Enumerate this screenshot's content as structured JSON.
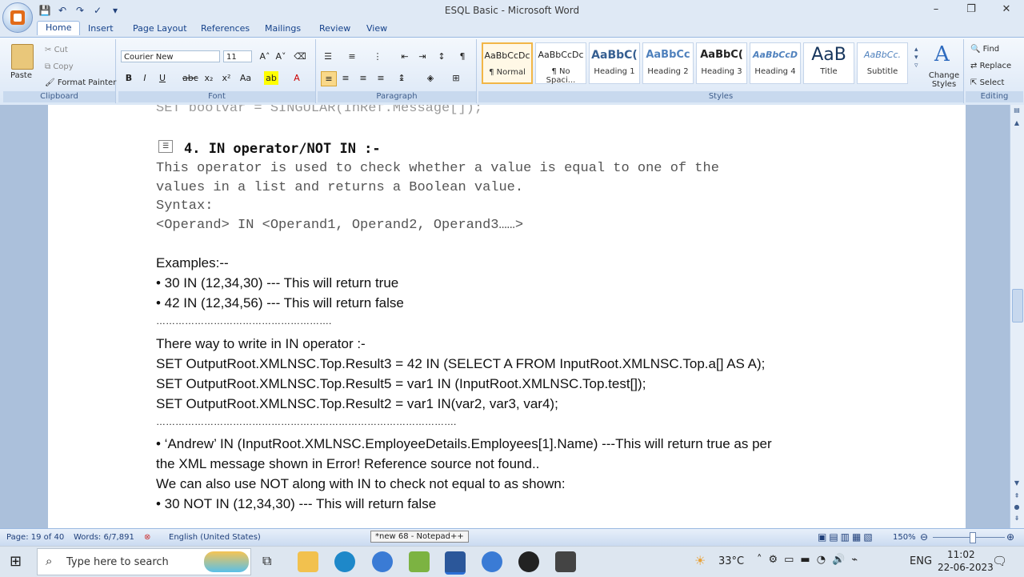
{
  "window": {
    "title": "ESQL Basic - Microsoft Word",
    "controls": [
      "–",
      "❐",
      "✕"
    ]
  },
  "tabs": [
    "Home",
    "Insert",
    "Page Layout",
    "References",
    "Mailings",
    "Review",
    "View"
  ],
  "ribbon": {
    "clipboard": {
      "paste": "Paste",
      "cut": "Cut",
      "copy": "Copy",
      "format_painter": "Format Painter",
      "label": "Clipboard"
    },
    "font": {
      "name": "Courier New",
      "size": "11",
      "label": "Font"
    },
    "paragraph": {
      "label": "Paragraph"
    },
    "styles": {
      "items": [
        {
          "preview": "AaBbCcDc",
          "name": "¶ Normal"
        },
        {
          "preview": "AaBbCcDc",
          "name": "¶ No Spaci..."
        },
        {
          "preview": "AaBbC(",
          "name": "Heading 1"
        },
        {
          "preview": "AaBbCc",
          "name": "Heading 2"
        },
        {
          "preview": "AaBbC(",
          "name": "Heading 3"
        },
        {
          "preview": "AaBbCcD",
          "name": "Heading 4"
        },
        {
          "preview": "AaB",
          "name": "Title"
        },
        {
          "preview": "AaBbCc.",
          "name": "Subtitle"
        }
      ],
      "change_styles": "Change Styles",
      "label": "Styles"
    },
    "editing": {
      "find": "Find",
      "replace": "Replace",
      "select": "Select",
      "label": "Editing"
    }
  },
  "document": {
    "cut_line": "SET boolvar = SINGULAR(InRef.Message[]);",
    "heading": "4. IN operator/NOT IN  :-",
    "desc1": "This operator is used to check whether a value is equal to one of the",
    "desc2": "values in a list and returns a Boolean value.",
    "syntax_label": "Syntax:",
    "syntax": "<Operand> IN <Operand1, Operand2, Operand3……>",
    "examples_label": "Examples:--",
    "ex1": "• 30 IN (12,34,30) --- This will return true",
    "ex2": " • 42 IN (12,34,56) --- This will return false",
    "dots1": "……………………………………………….",
    "three_ways": "There way to write in IN operator :-",
    "code1": "SET OutputRoot.XMLNSC.Top.Result3 = 42 IN (SELECT A FROM InputRoot.XMLNSC.Top.a[] AS A);",
    "code2": "SET OutputRoot.XMLNSC.Top.Result5 = var1 IN (InputRoot.XMLNSC.Top.test[]);",
    "code3": "SET OutputRoot.XMLNSC.Top.Result2 = var1 IN(var2, var3, var4);",
    "dots2": "………………………………………………………………………………….",
    "andrew1": "• ‘Andrew’ IN (InputRoot.XMLNSC.EmployeeDetails.Employees[1].Name) ---This will return true as per",
    "andrew2": "the XML message shown in Error! Reference source not found..",
    "notin": "We can also use NOT along with IN to check not equal to as shown:",
    "ex3": "• 30 NOT IN (12,34,30) --- This will return false"
  },
  "status": {
    "page": "Page: 19 of 40",
    "words": "Words: 6/7,891",
    "language": "English (United States)",
    "zoom": "150%"
  },
  "tooltip": "*new 68 - Notepad++",
  "taskbar": {
    "search_placeholder": "Type here to search",
    "weather": "33°C",
    "lang": "ENG",
    "time": "11:02",
    "date": "22-06-2023"
  }
}
